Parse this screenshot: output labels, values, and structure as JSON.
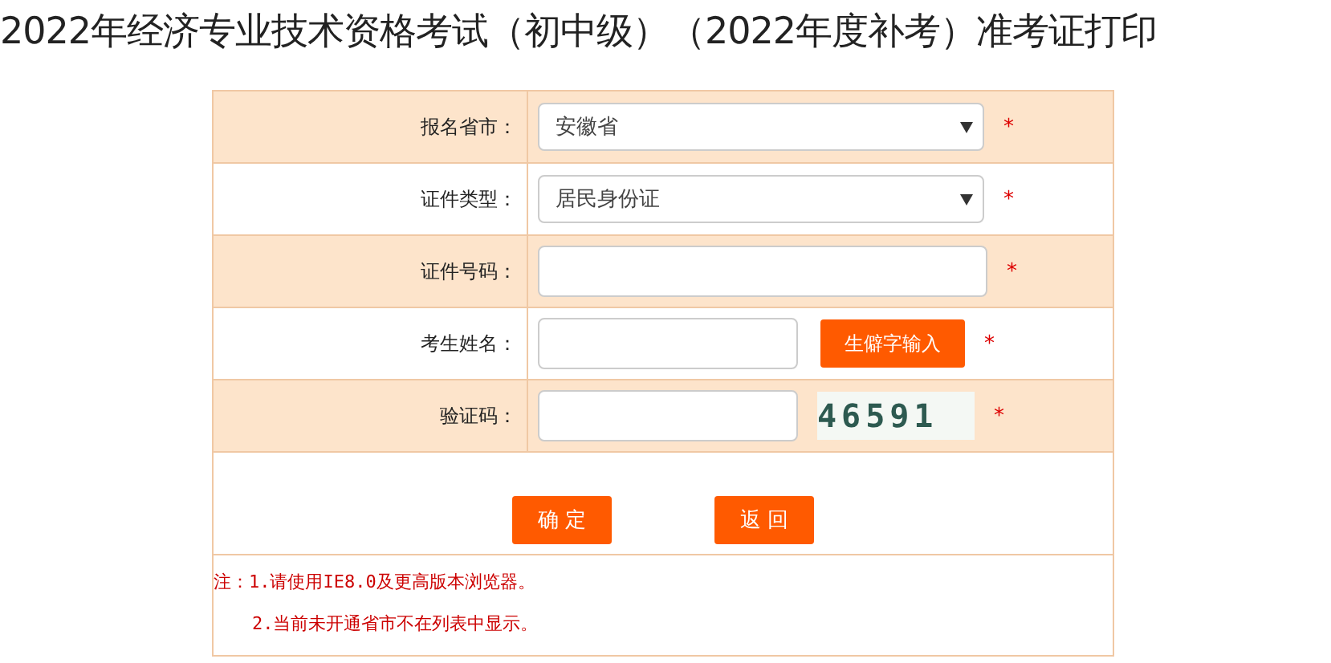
{
  "page_title": "2022年经济专业技术资格考试（初中级）（2022年度补考）准考证打印",
  "form": {
    "rows": [
      {
        "kind": "select",
        "label": "报名省市：",
        "value": "安徽省",
        "required": true
      },
      {
        "kind": "select",
        "label": "证件类型：",
        "value": "居民身份证",
        "required": true
      },
      {
        "kind": "input",
        "label": "证件号码：",
        "required": true
      },
      {
        "kind": "input_button",
        "label": "考生姓名：",
        "button": "生僻字输入",
        "required": true
      },
      {
        "kind": "captcha",
        "label": "验证码：",
        "captcha": "46591",
        "required": true
      }
    ],
    "required_mark": "*",
    "buttons": [
      "确 定",
      "返 回"
    ],
    "notes": [
      "注：1.请使用IE8.0及更高版本浏览器。",
      "2.当前未开通省市不在列表中显示。"
    ]
  }
}
